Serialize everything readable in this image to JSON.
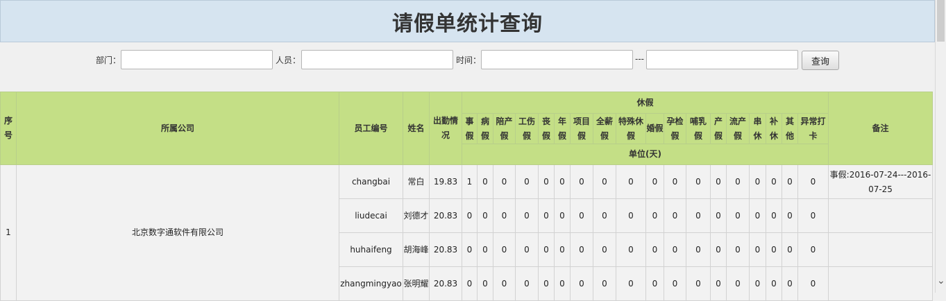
{
  "page": {
    "title": "请假单统计查询"
  },
  "filters": {
    "dept_label": "部门：",
    "person_label": "人员：",
    "time_label": "时间：",
    "separator": "---",
    "dept_value": "",
    "person_value": "",
    "start_value": "",
    "end_value": "",
    "query_label": "查询"
  },
  "table": {
    "headers": {
      "seq": "序号",
      "company": "所属公司",
      "emp_no": "员工编号",
      "name": "姓名",
      "attendance": "出勤情况",
      "leave_group": "休假",
      "unit": "单位(天)",
      "remark": "备注"
    },
    "leave_types": [
      "事假",
      "病假",
      "陪产假",
      "工伤假",
      "丧假",
      "年假",
      "项目假",
      "全薪假",
      "特殊休假",
      "婚假",
      "孕检假",
      "哺乳假",
      "产假",
      "流产假",
      "串休",
      "补休",
      "其他",
      "异常打卡"
    ],
    "group_seq": "1",
    "group_company": "北京数字通软件有限公司",
    "rows": [
      {
        "emp_no": "changbai",
        "name": "常白",
        "attendance": "19.83",
        "values": [
          "1",
          "0",
          "0",
          "0",
          "0",
          "0",
          "0",
          "0",
          "0",
          "0",
          "0",
          "0",
          "0",
          "0",
          "0",
          "0",
          "0",
          "0"
        ],
        "remark": "事假:2016-07-24---2016-07-25"
      },
      {
        "emp_no": "liudecai",
        "name": "刘德才",
        "attendance": "20.83",
        "values": [
          "0",
          "0",
          "0",
          "0",
          "0",
          "0",
          "0",
          "0",
          "0",
          "0",
          "0",
          "0",
          "0",
          "0",
          "0",
          "0",
          "0",
          "0"
        ],
        "remark": ""
      },
      {
        "emp_no": "huhaifeng",
        "name": "胡海峰",
        "attendance": "20.83",
        "values": [
          "0",
          "0",
          "0",
          "0",
          "0",
          "0",
          "0",
          "0",
          "0",
          "0",
          "0",
          "0",
          "0",
          "0",
          "0",
          "0",
          "0",
          "0"
        ],
        "remark": ""
      },
      {
        "emp_no": "zhangmingyao",
        "name": "张明耀",
        "attendance": "20.83",
        "values": [
          "0",
          "0",
          "0",
          "0",
          "0",
          "0",
          "0",
          "0",
          "0",
          "0",
          "0",
          "0",
          "0",
          "0",
          "0",
          "0",
          "0",
          "0"
        ],
        "remark": ""
      }
    ]
  }
}
